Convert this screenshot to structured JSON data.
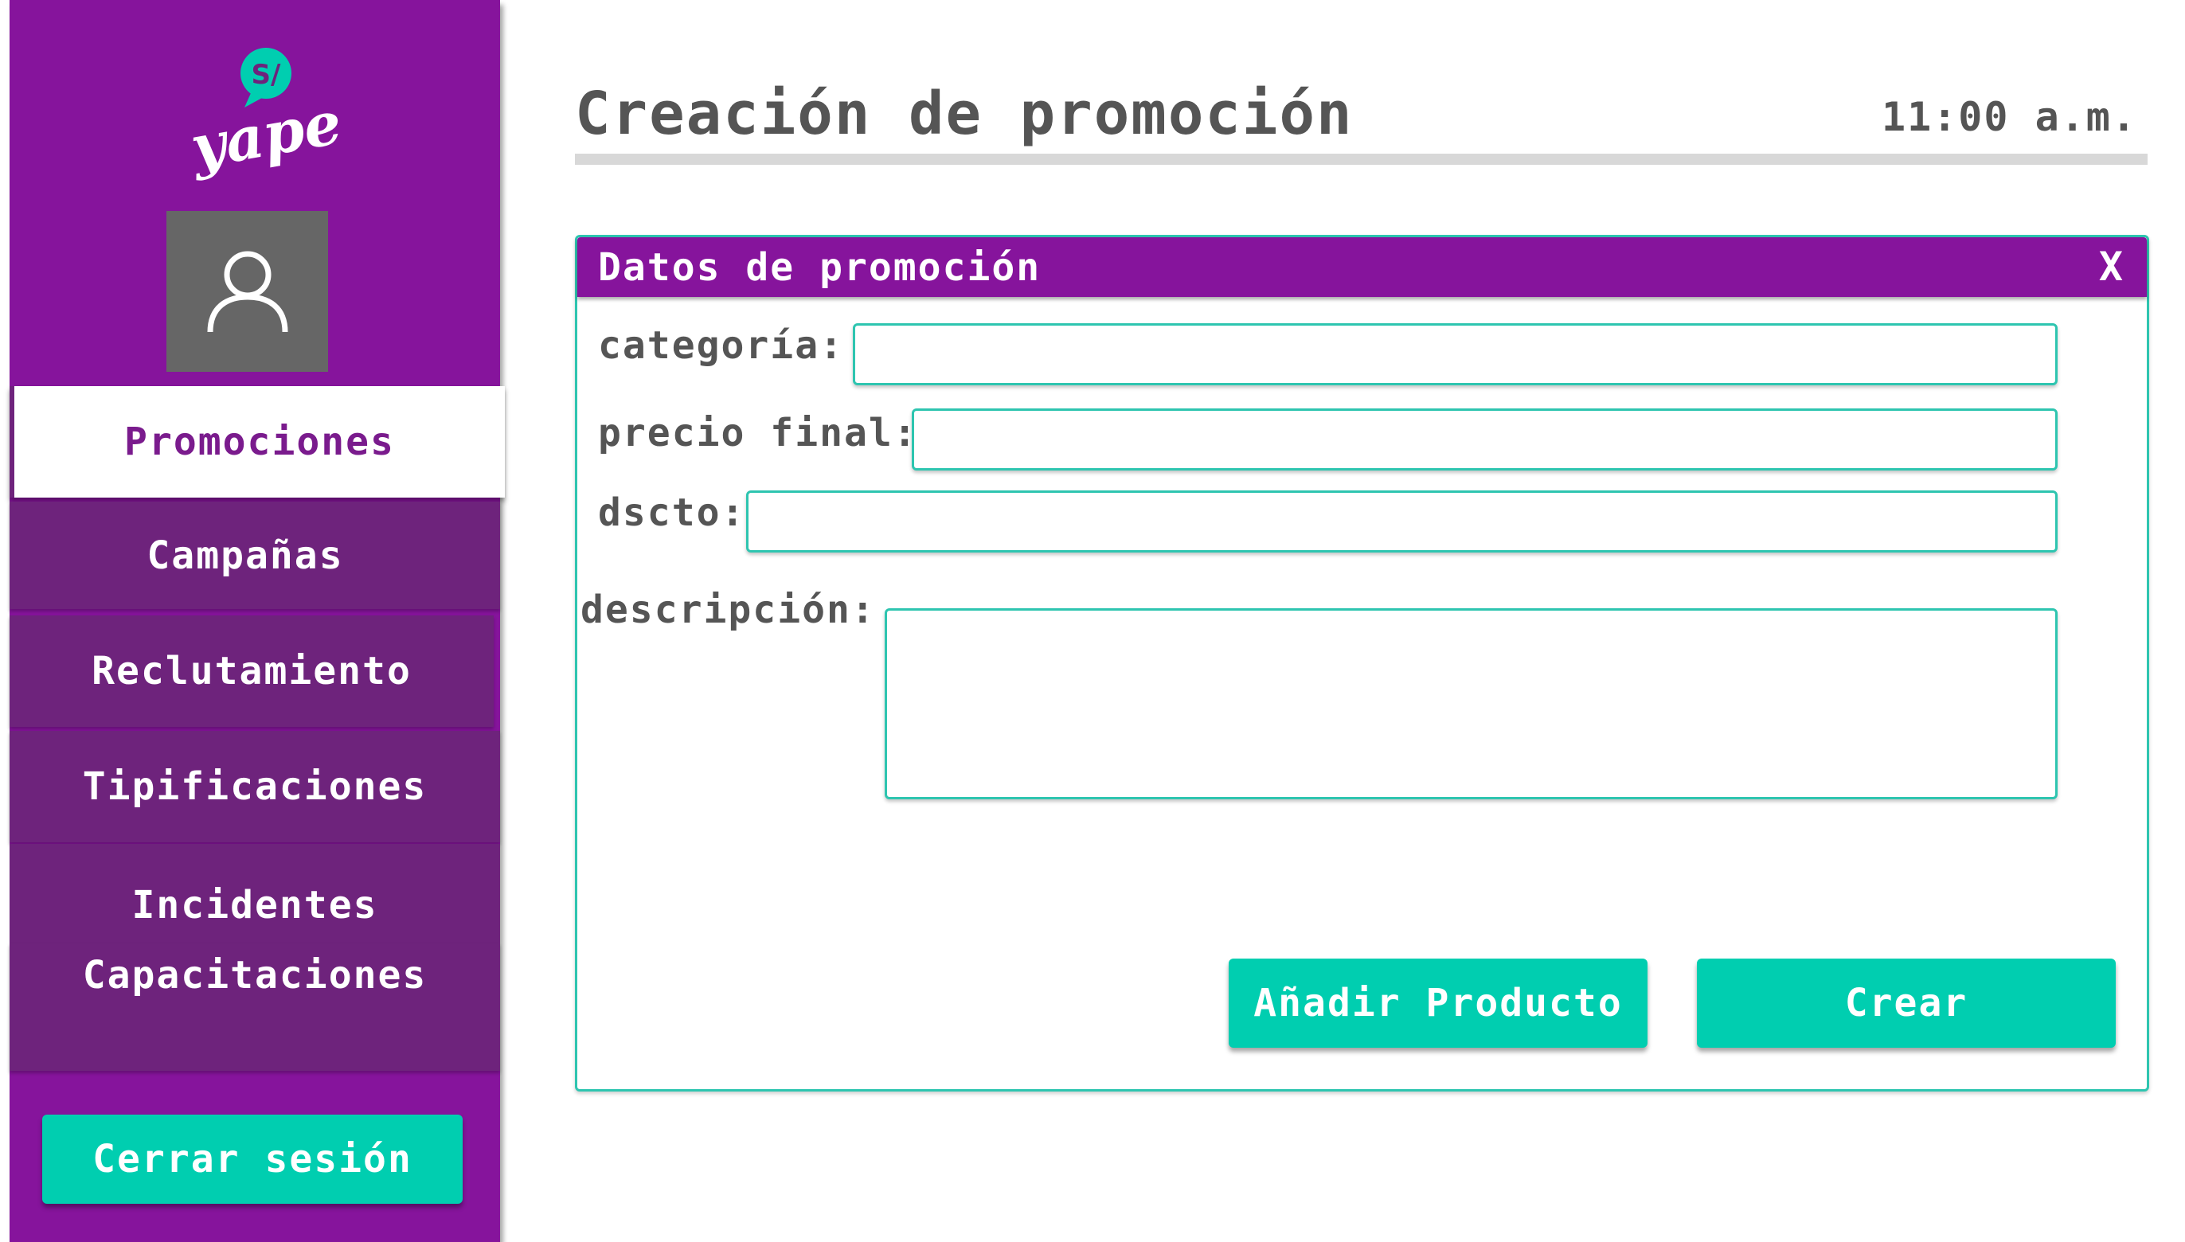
{
  "brand": {
    "logo_text": "yape",
    "logo_badge": "S/",
    "color": "#86149c",
    "accent": "#00ceb0"
  },
  "sidebar": {
    "avatar_icon": "user-icon",
    "items": [
      {
        "label": "Promociones",
        "active": true
      },
      {
        "label": "Campañas",
        "active": false
      },
      {
        "label": "Reclutamiento",
        "active": false
      },
      {
        "label": "Tipificaciones",
        "active": false
      },
      {
        "label": "Incidentes",
        "active": false
      },
      {
        "label": "Capacitaciones",
        "active": false
      }
    ],
    "logout_label": "Cerrar sesión"
  },
  "header": {
    "title": "Creación de promoción",
    "time": "11:00 a.m."
  },
  "panel": {
    "title": "Datos de promoción",
    "close_label": "X",
    "fields": {
      "categoria": {
        "label": "categoría:",
        "value": ""
      },
      "precio_final": {
        "label": "precio final:",
        "value": ""
      },
      "dscto": {
        "label": "dscto:",
        "value": ""
      },
      "descripcion": {
        "label": "descripción:",
        "value": ""
      }
    },
    "add_product_label": "Añadir Producto",
    "create_label": "Crear"
  }
}
